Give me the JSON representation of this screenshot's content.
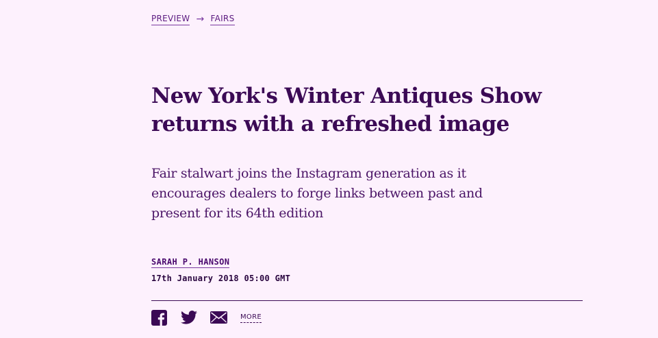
{
  "breadcrumb": {
    "items": [
      {
        "label": "PREVIEW"
      },
      {
        "label": "FAIRS"
      }
    ],
    "separator": "→"
  },
  "article": {
    "headline": "New York's Winter Antiques Show returns with a refreshed image",
    "standfirst": "Fair stalwart joins the Instagram generation as it encourages dealers to forge links between past and present for its 64th edition",
    "author": "SARAH P. HANSON",
    "date": "17th January 2018 05:00 GMT"
  },
  "share": {
    "icons": [
      "facebook-icon",
      "twitter-icon",
      "email-icon"
    ],
    "more_label": "MORE"
  },
  "colors": {
    "background": "#fdf1fd",
    "text": "#3b0a55",
    "accent": "#5b1a80"
  }
}
